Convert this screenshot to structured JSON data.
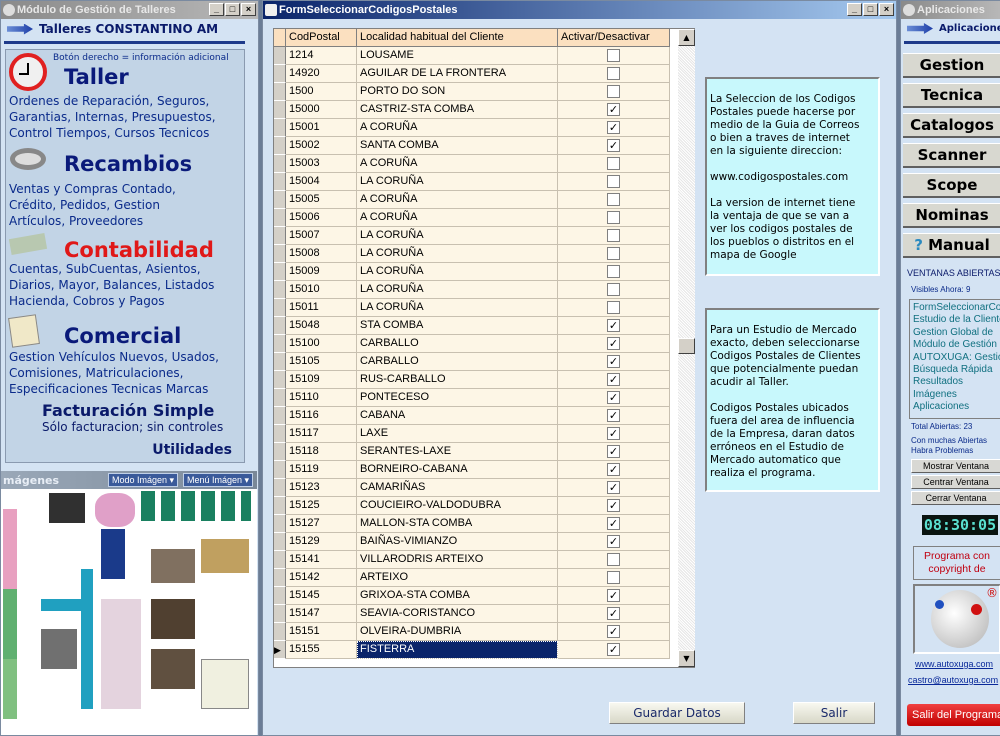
{
  "left_window": {
    "title": "Módulo de Gestión de Talleres",
    "header": "Talleres CONSTANTINO AM",
    "hint": "Botón derecho = información adicional",
    "sections": [
      {
        "title": "Taller",
        "lines": [
          "Ordenes de Reparación, Seguros,",
          "Garantias, Internas, Presupuestos,",
          "Control Tiempos, Cursos Tecnicos"
        ],
        "title_color": "#0a1a7a"
      },
      {
        "title": "Recambios",
        "lines": [
          "Ventas y Compras Contado,",
          "Crédito, Pedidos,  Gestion",
          "Artículos, Proveedores"
        ],
        "title_color": "#0a1a7a"
      },
      {
        "title": "Contabilidad",
        "lines": [
          "Cuentas, SubCuentas, Asientos,",
          "Diarios, Mayor, Balances, Listados",
          "Hacienda, Cobros y Pagos"
        ],
        "title_color": "#e01818"
      },
      {
        "title": "Comercial",
        "lines": [
          "Gestion Vehículos Nuevos, Usados,",
          "Comisiones, Matriculaciones,",
          "Especificaciones Tecnicas Marcas"
        ],
        "title_color": "#0a1a7a"
      }
    ],
    "facturacion_title": "Facturación Simple",
    "facturacion_text": "Sólo facturacion; sin controles",
    "utilidades": "Utilidades",
    "images_label": "mágenes",
    "modo_imagen": "Modo Imágen ▾",
    "menu_imagen": "Menú Imágen ▾"
  },
  "main_window": {
    "title": "FormSeleccionarCodigosPostales",
    "columns": [
      "CodPostal",
      "Localidad habitual del Cliente",
      "Activar/Desactivar"
    ],
    "rows": [
      [
        "1214",
        "LOUSAME",
        false
      ],
      [
        "14920",
        "AGUILAR DE LA FRONTERA",
        false
      ],
      [
        "1500",
        "PORTO DO SON",
        false
      ],
      [
        "15000",
        "CASTRIZ-STA COMBA",
        true
      ],
      [
        "15001",
        "A CORUÑA",
        true
      ],
      [
        "15002",
        "SANTA COMBA",
        true
      ],
      [
        "15003",
        "A CORUÑA",
        false
      ],
      [
        "15004",
        "LA CORUÑA",
        false
      ],
      [
        "15005",
        "A CORUÑA",
        false
      ],
      [
        "15006",
        "A CORUÑA",
        false
      ],
      [
        "15007",
        "LA CORUÑA",
        false
      ],
      [
        "15008",
        "LA CORUÑA",
        false
      ],
      [
        "15009",
        "LA CORUÑA",
        false
      ],
      [
        "15010",
        "LA CORUÑA",
        false
      ],
      [
        "15011",
        "LA CORUÑA",
        false
      ],
      [
        "15048",
        "STA COMBA",
        true
      ],
      [
        "15100",
        "CARBALLO",
        true
      ],
      [
        "15105",
        "CARBALLO",
        true
      ],
      [
        "15109",
        "RUS-CARBALLO",
        true
      ],
      [
        "15110",
        "PONTECESO",
        true
      ],
      [
        "15116",
        "CABANA",
        true
      ],
      [
        "15117",
        "LAXE",
        true
      ],
      [
        "15118",
        "SERANTES-LAXE",
        true
      ],
      [
        "15119",
        "BORNEIRO-CABANA",
        true
      ],
      [
        "15123",
        "CAMARIÑAS",
        true
      ],
      [
        "15125",
        "COUCIEIRO-VALDODUBRA",
        true
      ],
      [
        "15127",
        "MALLON-STA COMBA",
        true
      ],
      [
        "15129",
        "BAIÑAS-VIMIANZO",
        true
      ],
      [
        "15141",
        "VILLARODRIS ARTEIXO",
        false
      ],
      [
        "15142",
        "ARTEIXO",
        false
      ],
      [
        "15145",
        "GRIXOA-STA COMBA",
        true
      ],
      [
        "15147",
        "SEAVIA-CORISTANCO",
        true
      ],
      [
        "15151",
        "OLVEIRA-DUMBRIA",
        true
      ],
      [
        "15155",
        "FISTERRA",
        true
      ]
    ],
    "selected_row": 33,
    "info1": "La Seleccion de los Codigos\nPostales puede hacerse por\nmedio de la Guia de Correos\no bien a traves de internet\nen la  siguiente direccion:\n\nwww.codigospostales.com\n\nLa version de internet tiene\nla ventaja de que se van a\nver los codigos postales de\nlos pueblos o distritos en el\nmapa de Google",
    "info2": "Para un Estudio de Mercado\nexacto, deben seleccionarse\nCodigos Postales de Clientes\nque potencialmente puedan\nacudir al Taller.\n\nCodigos Postales ubicados\nfuera del area de influencia\nde la Empresa, daran datos\nerróneos en el Estudio de\nMercado automatico que\nrealiza el programa.",
    "save_label": "Guardar Datos",
    "exit_label": "Salir"
  },
  "right_window": {
    "title": "Aplicaciones",
    "header": "Aplicaciones",
    "apps": [
      "Gestion",
      "Tecnica",
      "Catalogos",
      "Scanner",
      "Scope",
      "Nominas",
      "Manual"
    ],
    "ventanas_title": "VENTANAS ABIERTAS",
    "visibles": "Visibles Ahora: 9",
    "windows": [
      "FormSeleccionarCodigosPostales",
      "Estudio de la Clientela",
      "Gestion Global de",
      "Módulo de Gestión",
      "AUTOXUGA:  Gestion",
      "Búsqueda Rápida",
      "Resultados",
      "Imágenes",
      "Aplicaciones"
    ],
    "total": "Total Abiertas: 23",
    "warning1": "Con muchas Abiertas",
    "warning2": "Habra Problemas",
    "show_btn": "Mostrar Ventana",
    "center_btn": "Centrar Ventana",
    "close_btn": "Cerrar Ventana",
    "clock": "08:30:05",
    "copyright": "Programa con copyright de",
    "website": "www.autoxuga.com",
    "email": "castro@autoxuga.com",
    "exit_program": "Salir del Programa",
    "registered": "®"
  }
}
